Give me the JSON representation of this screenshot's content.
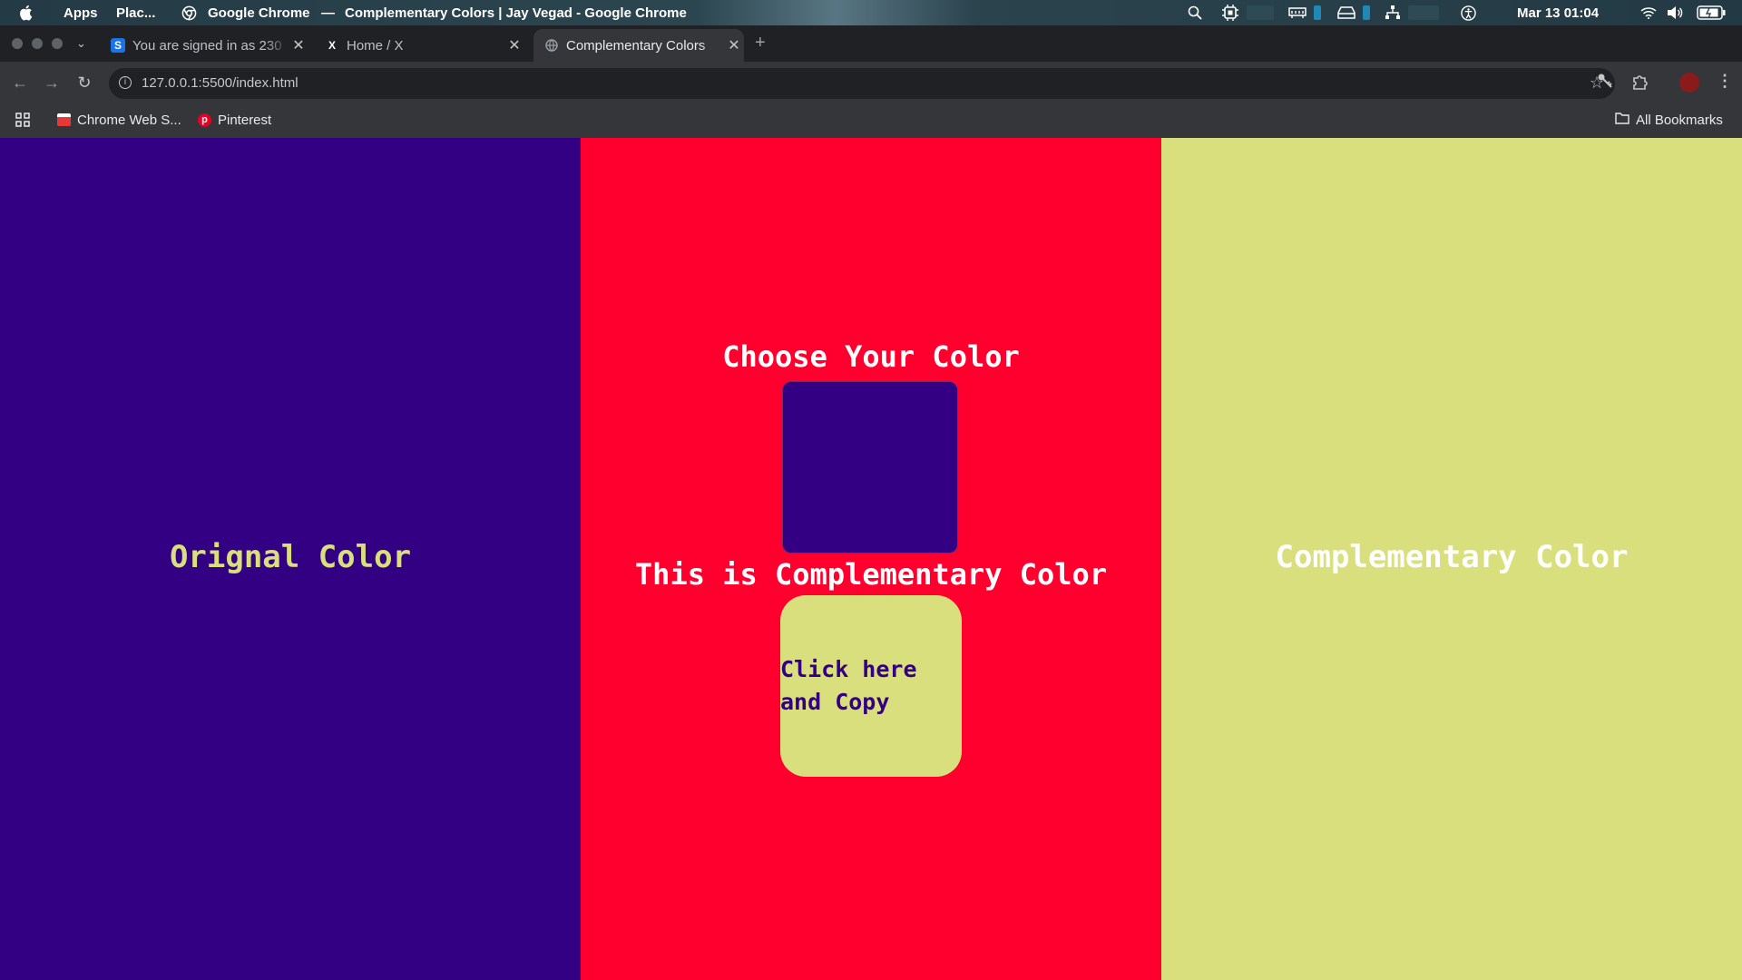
{
  "os_bar": {
    "apps_label": "Apps",
    "places_label": "Plac...",
    "app_name": "Google Chrome",
    "separator": "—",
    "window_title": "Complementary Colors | Jay Vegad - Google Chrome",
    "datetime": "Mar 13  01:04"
  },
  "tabs": [
    {
      "title": "You are signed in as 230",
      "favicon": "S",
      "favicon_color": "#1a73e8"
    },
    {
      "title": "Home / X",
      "favicon": "X",
      "favicon_color": "#000000"
    },
    {
      "title": "Complementary Colors",
      "favicon": "globe",
      "favicon_color": "#9aa0a6"
    }
  ],
  "new_tab_label": "+",
  "omnibox": {
    "url": "127.0.0.1:5500/index.html"
  },
  "bookmarks": {
    "items": [
      {
        "label": "Chrome Web S..."
      },
      {
        "label": "Pinterest"
      }
    ],
    "all_label": "All Bookmarks"
  },
  "page": {
    "original_label": "Orignal Color",
    "choose_heading": "Choose Your Color",
    "complementary_heading": "This is Complementary Color",
    "copy_button": "Click here and Copy",
    "complementary_label": "Complementary Color",
    "colors": {
      "original": "#340083",
      "middle_bg": "#ff002e",
      "complementary": "#d8df7c",
      "text_light": "#ffffff"
    }
  }
}
